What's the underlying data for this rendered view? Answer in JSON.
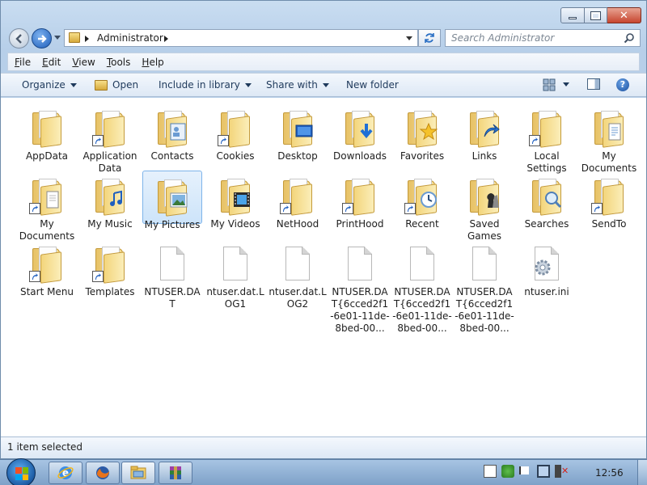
{
  "window": {
    "caption_buttons": [
      "minimize",
      "maximize",
      "close"
    ]
  },
  "address": {
    "path": "Administrator",
    "search_placeholder": "Search Administrator"
  },
  "menu": [
    {
      "label": "File",
      "underline": "F"
    },
    {
      "label": "Edit",
      "underline": "E"
    },
    {
      "label": "View",
      "underline": "V"
    },
    {
      "label": "Tools",
      "underline": "T"
    },
    {
      "label": "Help",
      "underline": "H"
    }
  ],
  "commands": {
    "organize": "Organize",
    "open": "Open",
    "include_in_library": "Include in library",
    "share_with": "Share with",
    "new_folder": "New folder"
  },
  "items": [
    {
      "label": "AppData",
      "kind": "folder",
      "shortcut": false,
      "icon": "plain-folder-icon"
    },
    {
      "label": "Application Data",
      "kind": "folder",
      "shortcut": true,
      "icon": "folder-shortcut-icon"
    },
    {
      "label": "Contacts",
      "kind": "folder",
      "shortcut": false,
      "icon": "contacts-folder-icon"
    },
    {
      "label": "Cookies",
      "kind": "folder",
      "shortcut": true,
      "icon": "folder-shortcut-icon"
    },
    {
      "label": "Desktop",
      "kind": "folder",
      "shortcut": false,
      "icon": "desktop-folder-icon"
    },
    {
      "label": "Downloads",
      "kind": "folder",
      "shortcut": false,
      "icon": "downloads-folder-icon"
    },
    {
      "label": "Favorites",
      "kind": "folder",
      "shortcut": false,
      "icon": "favorites-folder-icon"
    },
    {
      "label": "Links",
      "kind": "folder",
      "shortcut": false,
      "icon": "links-folder-icon"
    },
    {
      "label": "Local Settings",
      "kind": "folder",
      "shortcut": true,
      "icon": "folder-shortcut-icon"
    },
    {
      "label": "My Documents",
      "kind": "folder",
      "shortcut": false,
      "icon": "documents-folder-icon"
    },
    {
      "label": "My Documents",
      "kind": "folder",
      "shortcut": true,
      "icon": "documents-folder-shortcut-icon"
    },
    {
      "label": "My Music",
      "kind": "folder",
      "shortcut": false,
      "icon": "music-folder-icon"
    },
    {
      "label": "My Pictures",
      "kind": "folder",
      "shortcut": false,
      "icon": "pictures-folder-icon",
      "selected": true
    },
    {
      "label": "My Videos",
      "kind": "folder",
      "shortcut": false,
      "icon": "videos-folder-icon"
    },
    {
      "label": "NetHood",
      "kind": "folder",
      "shortcut": true,
      "icon": "folder-shortcut-icon"
    },
    {
      "label": "PrintHood",
      "kind": "folder",
      "shortcut": true,
      "icon": "folder-shortcut-icon"
    },
    {
      "label": "Recent",
      "kind": "folder",
      "shortcut": true,
      "icon": "recent-folder-icon"
    },
    {
      "label": "Saved Games",
      "kind": "folder",
      "shortcut": false,
      "icon": "saved-games-folder-icon"
    },
    {
      "label": "Searches",
      "kind": "folder",
      "shortcut": false,
      "icon": "searches-folder-icon"
    },
    {
      "label": "SendTo",
      "kind": "folder",
      "shortcut": true,
      "icon": "folder-shortcut-icon"
    },
    {
      "label": "Start Menu",
      "kind": "folder",
      "shortcut": true,
      "icon": "folder-shortcut-icon"
    },
    {
      "label": "Templates",
      "kind": "folder",
      "shortcut": true,
      "icon": "folder-shortcut-icon"
    },
    {
      "label": "NTUSER.DAT",
      "kind": "file",
      "icon": "blank-file-icon"
    },
    {
      "label": "ntuser.dat.LOG1",
      "kind": "file",
      "icon": "blank-file-icon"
    },
    {
      "label": "ntuser.dat.LOG2",
      "kind": "file",
      "icon": "blank-file-icon"
    },
    {
      "label": "NTUSER.DAT{6cced2f1-6e01-11de-8bed-00...",
      "kind": "file",
      "icon": "blank-file-icon"
    },
    {
      "label": "NTUSER.DAT{6cced2f1-6e01-11de-8bed-00...",
      "kind": "file",
      "icon": "blank-file-icon"
    },
    {
      "label": "NTUSER.DAT{6cced2f1-6e01-11de-8bed-00...",
      "kind": "file",
      "icon": "blank-file-icon"
    },
    {
      "label": "ntuser.ini",
      "kind": "file",
      "icon": "settings-file-icon"
    }
  ],
  "status": {
    "text": "1 item selected"
  },
  "taskbar": {
    "clock": "12:56",
    "pinned": [
      "internet-explorer-icon",
      "firefox-icon",
      "explorer-icon",
      "winrar-icon"
    ]
  },
  "colors": {
    "selection": "#cde4fa",
    "folder": "#f3d57c",
    "command_text": "#1e395b"
  }
}
